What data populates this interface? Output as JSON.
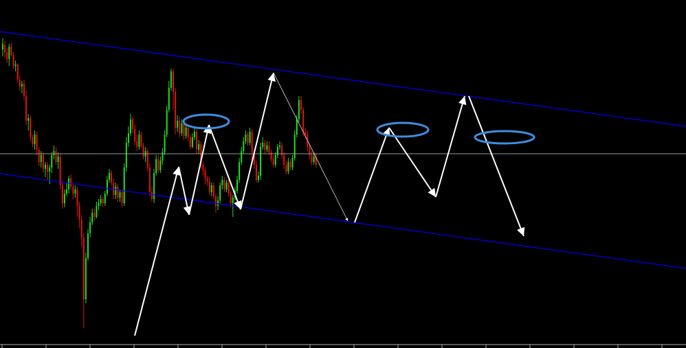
{
  "chart_data": {
    "type": "candlestick",
    "background": "#000000",
    "colors": {
      "bull": "#22e022",
      "bear": "#e01414",
      "channel": "#0000ff",
      "horizontal_level": "#9a9a9a",
      "arrows": "#ffffff",
      "ellipses": "#3d8fe0"
    },
    "candles": [
      [
        30,
        72,
        64,
        82,
        56
      ],
      [
        31,
        66,
        76,
        84,
        60
      ],
      [
        31,
        76,
        86,
        92,
        70
      ],
      [
        32,
        86,
        68,
        96,
        64
      ],
      [
        32,
        68,
        80,
        82,
        62
      ],
      [
        33,
        80,
        96,
        100,
        76
      ],
      [
        33,
        96,
        94,
        104,
        88
      ],
      [
        34,
        94,
        116,
        120,
        92
      ],
      [
        34,
        116,
        126,
        132,
        110
      ],
      [
        35,
        126,
        122,
        136,
        118
      ],
      [
        35,
        122,
        140,
        146,
        116
      ],
      [
        36,
        140,
        176,
        182,
        132
      ],
      [
        36,
        176,
        172,
        190,
        166
      ],
      [
        37,
        172,
        200,
        206,
        168
      ],
      [
        37,
        200,
        210,
        214,
        196
      ],
      [
        38,
        210,
        196,
        218,
        190
      ],
      [
        38,
        196,
        218,
        226,
        192
      ],
      [
        39,
        218,
        236,
        242,
        214
      ],
      [
        39,
        236,
        226,
        244,
        220
      ],
      [
        40,
        226,
        246,
        252,
        222
      ],
      [
        40,
        246,
        240,
        258,
        236
      ],
      [
        41,
        240,
        250,
        262,
        236
      ],
      [
        41,
        250,
        244,
        268,
        240
      ],
      [
        42,
        244,
        226,
        252,
        222
      ],
      [
        42,
        226,
        220,
        232,
        212
      ],
      [
        43,
        220,
        236,
        240,
        214
      ],
      [
        43,
        236,
        228,
        246,
        222
      ],
      [
        44,
        228,
        270,
        276,
        224
      ],
      [
        44,
        270,
        296,
        304,
        264
      ],
      [
        45,
        296,
        282,
        302,
        276
      ],
      [
        45,
        282,
        276,
        286,
        266
      ],
      [
        46,
        276,
        260,
        282,
        256
      ],
      [
        46,
        260,
        272,
        276,
        254
      ],
      [
        47,
        272,
        282,
        290,
        268
      ],
      [
        47,
        282,
        276,
        288,
        270
      ],
      [
        48,
        276,
        300,
        316,
        272
      ],
      [
        48,
        300,
        320,
        332,
        294
      ],
      [
        49,
        320,
        346,
        360,
        314
      ],
      [
        49,
        346,
        436,
        478,
        340
      ],
      [
        50,
        436,
        376,
        442,
        368
      ],
      [
        50,
        376,
        340,
        380,
        334
      ],
      [
        51,
        340,
        324,
        346,
        316
      ],
      [
        51,
        324,
        310,
        328,
        304
      ],
      [
        52,
        310,
        316,
        322,
        304
      ],
      [
        52,
        316,
        300,
        318,
        294
      ],
      [
        53,
        300,
        296,
        306,
        290
      ],
      [
        53,
        296,
        290,
        300,
        284
      ],
      [
        54,
        290,
        296,
        302,
        286
      ],
      [
        54,
        296,
        282,
        300,
        278
      ],
      [
        55,
        282,
        262,
        286,
        256
      ],
      [
        55,
        262,
        252,
        266,
        246
      ],
      [
        56,
        252,
        266,
        270,
        248
      ],
      [
        56,
        266,
        284,
        290,
        260
      ],
      [
        57,
        284,
        272,
        290,
        266
      ],
      [
        57,
        272,
        288,
        294,
        268
      ],
      [
        58,
        288,
        280,
        294,
        276
      ],
      [
        58,
        280,
        296,
        302,
        276
      ],
      [
        59,
        296,
        244,
        300,
        238
      ],
      [
        59,
        244,
        208,
        250,
        200
      ],
      [
        60,
        208,
        194,
        214,
        184
      ],
      [
        60,
        194,
        174,
        198,
        166
      ],
      [
        61,
        174,
        188,
        194,
        170
      ],
      [
        61,
        188,
        206,
        212,
        182
      ],
      [
        62,
        206,
        214,
        220,
        196
      ],
      [
        62,
        214,
        196,
        218,
        190
      ],
      [
        63,
        196,
        212,
        216,
        192
      ],
      [
        63,
        212,
        228,
        232,
        208
      ],
      [
        64,
        228,
        220,
        236,
        214
      ],
      [
        64,
        220,
        244,
        250,
        216
      ],
      [
        65,
        244,
        280,
        286,
        238
      ],
      [
        65,
        280,
        290,
        294,
        272
      ],
      [
        66,
        290,
        252,
        296,
        246
      ],
      [
        66,
        252,
        232,
        256,
        226
      ],
      [
        67,
        232,
        248,
        252,
        226
      ],
      [
        67,
        248,
        234,
        252,
        228
      ],
      [
        68,
        234,
        222,
        240,
        216
      ],
      [
        68,
        222,
        196,
        226,
        190
      ],
      [
        69,
        196,
        160,
        200,
        154
      ],
      [
        69,
        160,
        128,
        164,
        118
      ],
      [
        70,
        128,
        104,
        132,
        100
      ],
      [
        70,
        104,
        134,
        160,
        100
      ],
      [
        71,
        134,
        186,
        196,
        128
      ],
      [
        71,
        186,
        176,
        192,
        168
      ],
      [
        72,
        176,
        194,
        200,
        170
      ],
      [
        72,
        194,
        180,
        198,
        174
      ],
      [
        73,
        180,
        198,
        204,
        176
      ],
      [
        73,
        198,
        186,
        202,
        180
      ],
      [
        74,
        186,
        200,
        206,
        182
      ],
      [
        74,
        200,
        214,
        218,
        196
      ],
      [
        75,
        214,
        200,
        216,
        194
      ],
      [
        75,
        200,
        192,
        204,
        186
      ],
      [
        76,
        192,
        218,
        224,
        188
      ],
      [
        76,
        218,
        210,
        224,
        204
      ],
      [
        77,
        210,
        240,
        246,
        206
      ],
      [
        77,
        240,
        248,
        256,
        236
      ],
      [
        78,
        248,
        260,
        268,
        244
      ],
      [
        78,
        260,
        264,
        270,
        256
      ],
      [
        79,
        264,
        280,
        284,
        258
      ],
      [
        79,
        280,
        270,
        286,
        266
      ],
      [
        80,
        270,
        286,
        290,
        266
      ],
      [
        80,
        286,
        300,
        310,
        282
      ],
      [
        81,
        300,
        292,
        306,
        286
      ],
      [
        81,
        292,
        270,
        296,
        266
      ],
      [
        82,
        270,
        262,
        276,
        256
      ],
      [
        82,
        262,
        276,
        280,
        258
      ],
      [
        83,
        276,
        266,
        280,
        262
      ],
      [
        83,
        266,
        282,
        286,
        262
      ],
      [
        84,
        282,
        296,
        302,
        278
      ],
      [
        84,
        296,
        288,
        316,
        284
      ],
      [
        85,
        288,
        278,
        292,
        272
      ],
      [
        85,
        278,
        262,
        282,
        256
      ],
      [
        86,
        262,
        236,
        266,
        230
      ],
      [
        86,
        236,
        220,
        240,
        214
      ],
      [
        87,
        220,
        206,
        224,
        200
      ],
      [
        87,
        206,
        196,
        210,
        190
      ],
      [
        88,
        196,
        208,
        212,
        192
      ],
      [
        88,
        208,
        192,
        212,
        186
      ],
      [
        89,
        192,
        222,
        232,
        188
      ],
      [
        89,
        222,
        240,
        246,
        218
      ],
      [
        90,
        240,
        262,
        266,
        234
      ],
      [
        90,
        262,
        256,
        266,
        250
      ],
      [
        91,
        256,
        214,
        262,
        208
      ],
      [
        91,
        214,
        208,
        218,
        200
      ],
      [
        92,
        208,
        218,
        224,
        204
      ],
      [
        92,
        218,
        212,
        222,
        206
      ],
      [
        93,
        212,
        222,
        226,
        206
      ],
      [
        93,
        222,
        232,
        236,
        218
      ],
      [
        94,
        232,
        240,
        244,
        226
      ],
      [
        94,
        240,
        226,
        244,
        222
      ],
      [
        95,
        226,
        214,
        230,
        210
      ],
      [
        95,
        214,
        212,
        218,
        206
      ],
      [
        96,
        212,
        226,
        232,
        208
      ],
      [
        96,
        226,
        240,
        246,
        222
      ],
      [
        97,
        240,
        250,
        254,
        234
      ],
      [
        97,
        250,
        236,
        254,
        230
      ],
      [
        98,
        236,
        244,
        248,
        232
      ],
      [
        98,
        244,
        230,
        248,
        226
      ],
      [
        99,
        230,
        196,
        234,
        190
      ],
      [
        99,
        196,
        174,
        200,
        168
      ],
      [
        100,
        174,
        146,
        178,
        140
      ],
      [
        100,
        146,
        160,
        166,
        140
      ],
      [
        101,
        160,
        192,
        198,
        156
      ],
      [
        101,
        192,
        196,
        202,
        186
      ],
      [
        102,
        196,
        214,
        220,
        190
      ],
      [
        102,
        214,
        226,
        232,
        210
      ],
      [
        103,
        226,
        236,
        240,
        220
      ],
      [
        103,
        236,
        228,
        240,
        222
      ],
      [
        104,
        228,
        240,
        244,
        224
      ]
    ]
  }
}
